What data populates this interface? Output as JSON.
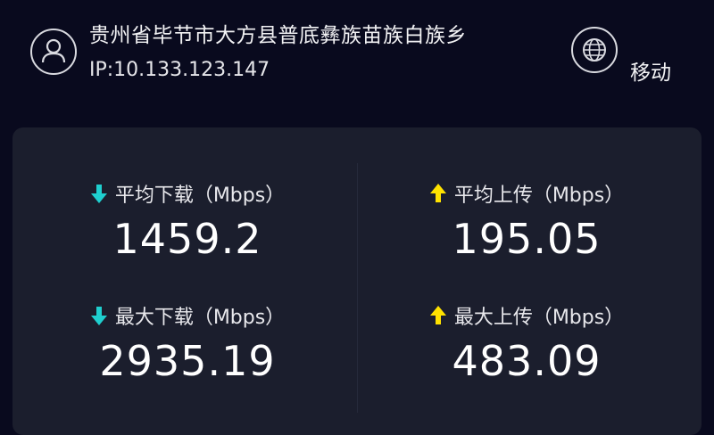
{
  "header": {
    "location": "贵州省毕节市大方县普底彝族苗族白族乡",
    "ip": "IP:10.133.123.147",
    "carrier": "移动",
    "avatar_icon": "user-icon",
    "carrier_icon": "globe-icon"
  },
  "stats": {
    "avg_download": {
      "label": "平均下载（Mbps）",
      "value": "1459.2",
      "icon": "arrow-down-icon"
    },
    "avg_upload": {
      "label": "平均上传（Mbps）",
      "value": "195.05",
      "icon": "arrow-up-icon"
    },
    "max_download": {
      "label": "最大下载（Mbps）",
      "value": "2935.19",
      "icon": "arrow-down-icon"
    },
    "max_upload": {
      "label": "最大上传（Mbps）",
      "value": "483.09",
      "icon": "arrow-up-icon"
    }
  },
  "colors": {
    "background": "#090a1e",
    "card": "#1b1e2d",
    "download_arrow": "#1fcfcf",
    "upload_arrow": "#ffe200"
  }
}
